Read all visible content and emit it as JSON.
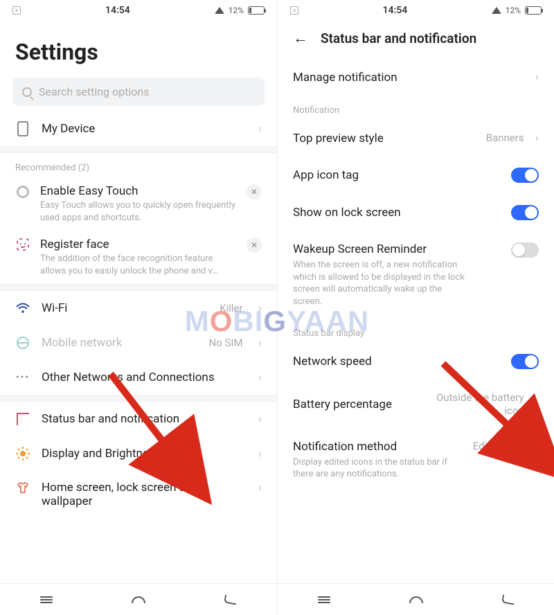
{
  "statusbar": {
    "time": "14:54",
    "battery_pct": "12%"
  },
  "left": {
    "title": "Settings",
    "search_placeholder": "Search setting options",
    "device_label": "My Device",
    "recommended_header": "Recommended (2)",
    "rec": [
      {
        "title": "Enable Easy Touch",
        "desc": "Easy Touch allows you to quickly open frequently used apps and shortcuts."
      },
      {
        "title": "Register face",
        "desc": "The addition of the face recognition feature allows you to easily unlock the phone and v…"
      }
    ],
    "items": [
      {
        "label": "Wi-Fi",
        "value": "Killer"
      },
      {
        "label": "Mobile network",
        "value": "No SIM"
      },
      {
        "label": "Other Networks and Connections",
        "value": ""
      },
      {
        "label": "Status bar and notification",
        "value": ""
      },
      {
        "label": "Display and Brightness",
        "value": ""
      },
      {
        "label": "Home screen, lock screen and wallpaper",
        "value": ""
      }
    ]
  },
  "right": {
    "title": "Status bar and notification",
    "manage": "Manage notification",
    "section_notification": "Notification",
    "top_preview": {
      "label": "Top preview style",
      "value": "Banners"
    },
    "app_icon_tag": {
      "label": "App icon tag",
      "on": true
    },
    "show_lock": {
      "label": "Show on lock screen",
      "on": true
    },
    "wakeup": {
      "label": "Wakeup Screen Reminder",
      "desc": "When the screen is off, a new notification which is allowed to be displayed in the lock screen will automatically wake up the screen.",
      "on": false
    },
    "section_statusbar": "Status bar display",
    "network_speed": {
      "label": "Network speed",
      "on": true
    },
    "battery_pct": {
      "label": "Battery percentage",
      "value": "Outside the battery icon"
    },
    "notif_method": {
      "label": "Notification method",
      "desc": "Display edited icons in the status bar if there are any notifications.",
      "value": "Edited icon"
    }
  },
  "watermark": "MOBIGYAAN"
}
